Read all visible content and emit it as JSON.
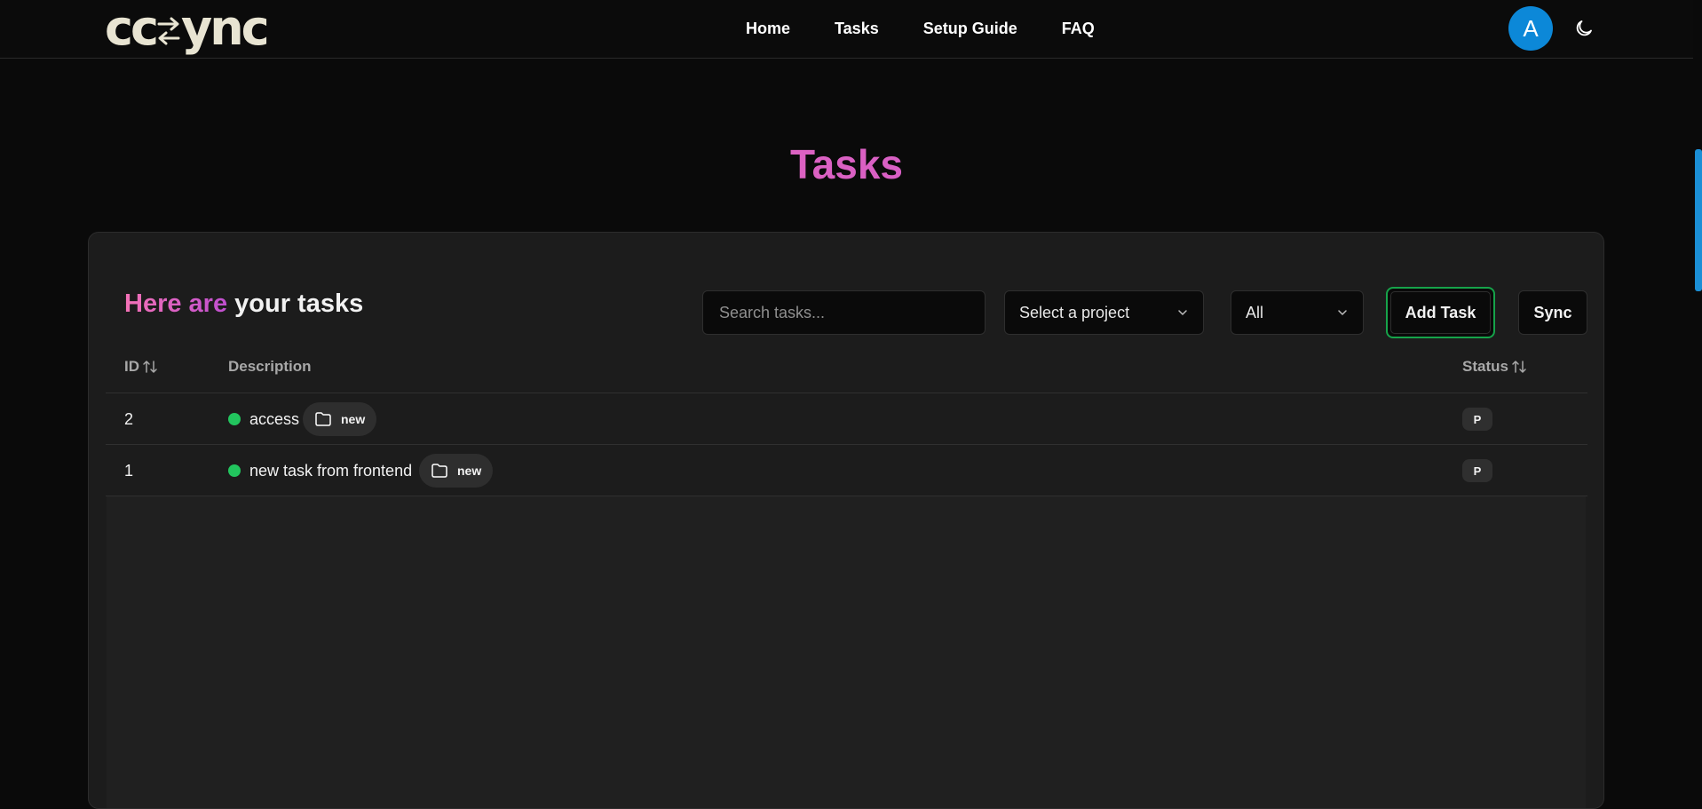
{
  "header": {
    "logo_text_left": "cc",
    "logo_text_right": "ync",
    "nav": [
      {
        "label": "Home"
      },
      {
        "label": "Tasks"
      },
      {
        "label": "Setup Guide"
      },
      {
        "label": "FAQ"
      }
    ],
    "avatar_initial": "A",
    "theme_toggle_icon": "moon-icon"
  },
  "page": {
    "title": "Tasks"
  },
  "panel": {
    "heading_accent": "Here are",
    "heading_rest": "your tasks",
    "search": {
      "placeholder": "Search tasks...",
      "value": ""
    },
    "project_select": {
      "value": "Select a project"
    },
    "status_select": {
      "value": "All"
    },
    "add_task_label": "Add Task",
    "sync_label": "Sync",
    "columns": {
      "id": "ID",
      "description": "Description",
      "status": "Status"
    },
    "rows": [
      {
        "id": "2",
        "description": "access",
        "project": "new",
        "status": "P"
      },
      {
        "id": "1",
        "description": "new task from frontend",
        "project": "new",
        "status": "P"
      }
    ]
  },
  "colors": {
    "accent_gradient": [
      "#f472b6",
      "#c04fd0"
    ],
    "add_task_border": "#16a34a",
    "status_dot": "#22c55e",
    "avatar": "#0c88d8"
  }
}
